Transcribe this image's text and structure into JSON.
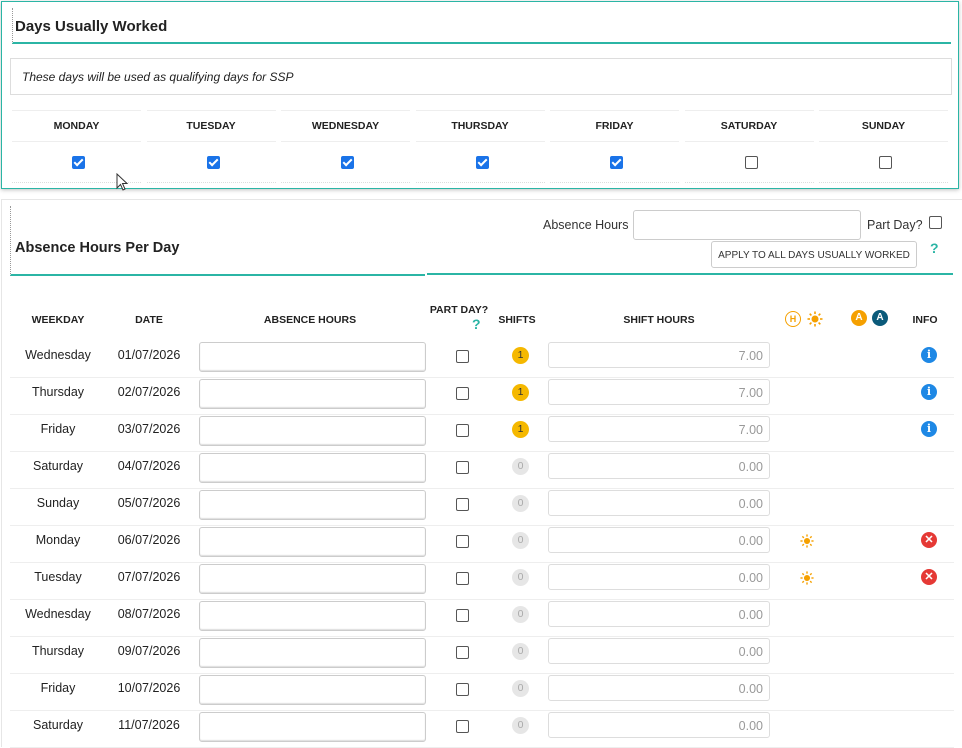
{
  "days_section": {
    "title": "Days Usually Worked",
    "note": "These days will be used as qualifying days for SSP",
    "days": [
      {
        "label": "MONDAY",
        "checked": true
      },
      {
        "label": "TUESDAY",
        "checked": true
      },
      {
        "label": "WEDNESDAY",
        "checked": true
      },
      {
        "label": "THURSDAY",
        "checked": true
      },
      {
        "label": "FRIDAY",
        "checked": true
      },
      {
        "label": "SATURDAY",
        "checked": false
      },
      {
        "label": "SUNDAY",
        "checked": false
      }
    ]
  },
  "absence_section": {
    "title": "Absence Hours Per Day",
    "absence_hours_label": "Absence Hours",
    "absence_hours_value": "",
    "part_day_label": "Part Day?",
    "apply_button": "APPLY TO ALL DAYS USUALLY WORKED",
    "help_glyph": "?",
    "columns": {
      "weekday": "WEEKDAY",
      "date": "DATE",
      "absence_hours": "ABSENCE HOURS",
      "part_day": "PART DAY?",
      "shifts": "SHIFTS",
      "shift_hours": "SHIFT HOURS",
      "info": "INFO"
    },
    "header_icons": {
      "holiday_badge": "H",
      "absence_badge_orange": "A",
      "absence_badge_blue": "A",
      "sun_icon": "sun-icon"
    },
    "colors": {
      "accent": "#2bb5a5",
      "shift_badge": "#f5b800",
      "info": "#1e88e5",
      "error": "#e53935",
      "check": "#1a73e8"
    },
    "rows": [
      {
        "weekday": "Wednesday",
        "date": "01/07/2026",
        "shifts": "1",
        "shift_hours": "7.00",
        "holiday": false,
        "status": "info"
      },
      {
        "weekday": "Thursday",
        "date": "02/07/2026",
        "shifts": "1",
        "shift_hours": "7.00",
        "holiday": false,
        "status": "info"
      },
      {
        "weekday": "Friday",
        "date": "03/07/2026",
        "shifts": "1",
        "shift_hours": "7.00",
        "holiday": false,
        "status": "info"
      },
      {
        "weekday": "Saturday",
        "date": "04/07/2026",
        "shifts": "0",
        "shift_hours": "0.00",
        "holiday": false,
        "status": "none"
      },
      {
        "weekday": "Sunday",
        "date": "05/07/2026",
        "shifts": "0",
        "shift_hours": "0.00",
        "holiday": false,
        "status": "none"
      },
      {
        "weekday": "Monday",
        "date": "06/07/2026",
        "shifts": "0",
        "shift_hours": "0.00",
        "holiday": true,
        "status": "error"
      },
      {
        "weekday": "Tuesday",
        "date": "07/07/2026",
        "shifts": "0",
        "shift_hours": "0.00",
        "holiday": true,
        "status": "error"
      },
      {
        "weekday": "Wednesday",
        "date": "08/07/2026",
        "shifts": "0",
        "shift_hours": "0.00",
        "holiday": false,
        "status": "none"
      },
      {
        "weekday": "Thursday",
        "date": "09/07/2026",
        "shifts": "0",
        "shift_hours": "0.00",
        "holiday": false,
        "status": "none"
      },
      {
        "weekday": "Friday",
        "date": "10/07/2026",
        "shifts": "0",
        "shift_hours": "0.00",
        "holiday": false,
        "status": "none"
      },
      {
        "weekday": "Saturday",
        "date": "11/07/2026",
        "shifts": "0",
        "shift_hours": "0.00",
        "holiday": false,
        "status": "none"
      }
    ]
  }
}
